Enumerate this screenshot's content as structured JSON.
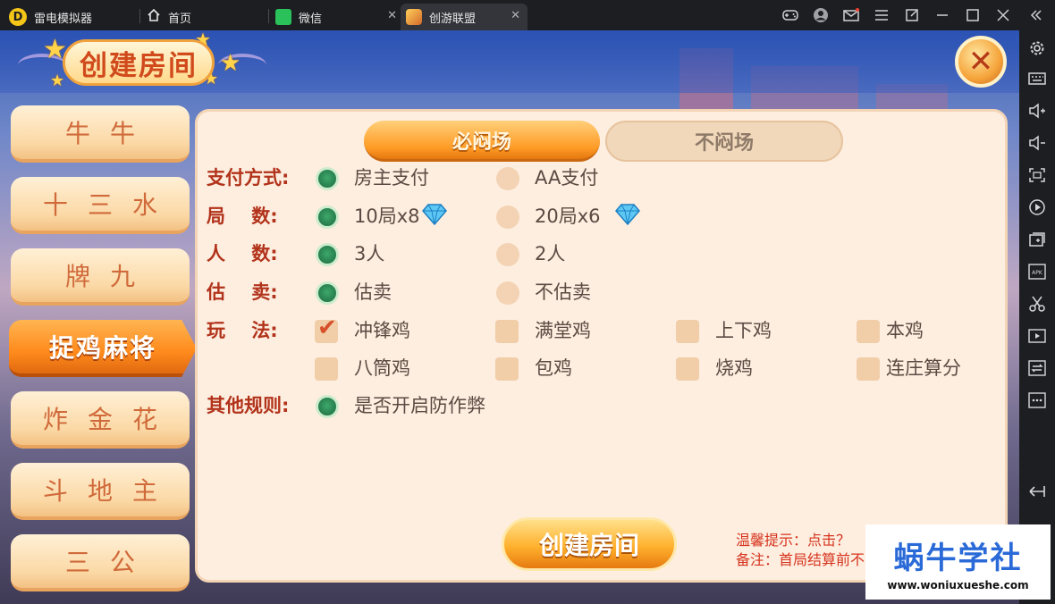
{
  "titlebar": {
    "app_name": "雷电模拟器",
    "tabs": [
      {
        "label": "首页"
      },
      {
        "label": "微信"
      },
      {
        "label": "创游联盟"
      }
    ]
  },
  "game": {
    "title": "创建房间",
    "menu": [
      {
        "label": "牛牛",
        "active": false
      },
      {
        "label": "十三水",
        "active": false
      },
      {
        "label": "牌九",
        "active": false
      },
      {
        "label": "捉鸡麻将",
        "active": true
      },
      {
        "label": "炸金花",
        "active": false
      },
      {
        "label": "斗地主",
        "active": false
      },
      {
        "label": "三公",
        "active": false
      }
    ],
    "mode_tabs": {
      "selected": "必闷场",
      "other": "不闷场"
    },
    "rules": {
      "pay_label": "支付方式:",
      "pay_opt1": "房主支付",
      "pay_opt2": "AA支付",
      "rounds_label": "局    数:",
      "rounds_opt1": "10局x8",
      "rounds_opt2": "20局x6",
      "players_label": "人    数:",
      "players_opt1": "3人",
      "players_opt2": "2人",
      "sell_label": "估    卖:",
      "sell_opt1": "估卖",
      "sell_opt2": "不估卖",
      "play_label": "玩    法:",
      "play_opts": [
        "冲锋鸡",
        "满堂鸡",
        "上下鸡",
        "本鸡",
        "八筒鸡",
        "包鸡",
        "烧鸡",
        "连庄算分"
      ],
      "other_label": "其他规则:",
      "other_opt": "是否开启防作弊"
    },
    "create_button": "创建房间",
    "tip_line1": "温馨提示：点击？",
    "tip_line2": "备注：首局结算前不"
  },
  "watermark": {
    "title": "蜗牛学社",
    "url": "www.woniuxueshe.com"
  },
  "colors": {
    "accent_orange": "#ff9c26",
    "label_red": "#b2331b",
    "radio_green": "#2b8653"
  }
}
